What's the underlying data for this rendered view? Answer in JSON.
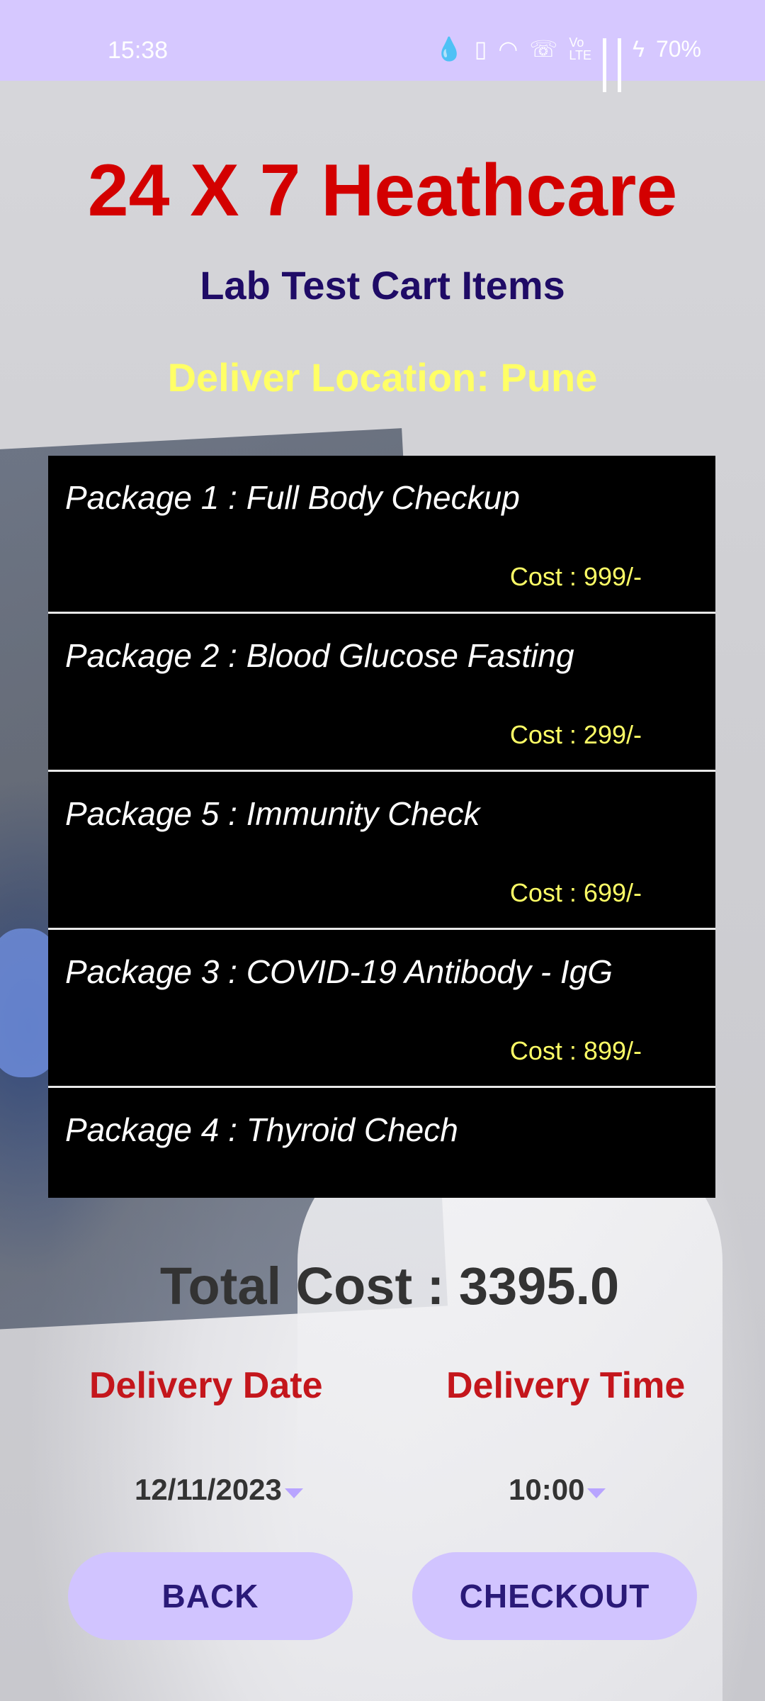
{
  "status_bar": {
    "time": "15:38",
    "battery": "70%",
    "icons": [
      "water-drop-icon",
      "vibrate-icon",
      "wifi-icon",
      "wifi-call-icon",
      "volte-icon",
      "signal-icon",
      "signal-icon",
      "charging-icon"
    ]
  },
  "header": {
    "title": "24 X 7 Heathcare",
    "subtitle": "Lab Test Cart Items",
    "location": "Deliver Location: Pune"
  },
  "cart": {
    "items": [
      {
        "name": "Package 1 : Full Body Checkup",
        "cost": "Cost : 999/-"
      },
      {
        "name": "Package 2 : Blood Glucose Fasting",
        "cost": "Cost : 299/-"
      },
      {
        "name": "Package 5 : Immunity Check",
        "cost": "Cost : 699/-"
      },
      {
        "name": "Package 3 : COVID-19 Antibody - IgG",
        "cost": "Cost : 899/-"
      },
      {
        "name": "Package 4 : Thyroid Chech",
        "cost": ""
      }
    ]
  },
  "summary": {
    "total": "Total Cost : 3395.0"
  },
  "delivery": {
    "date_label": "Delivery Date",
    "time_label": "Delivery Time",
    "date_value": "12/11/2023",
    "time_value": "10:00"
  },
  "buttons": {
    "back": "BACK",
    "checkout": "CHECKOUT"
  }
}
